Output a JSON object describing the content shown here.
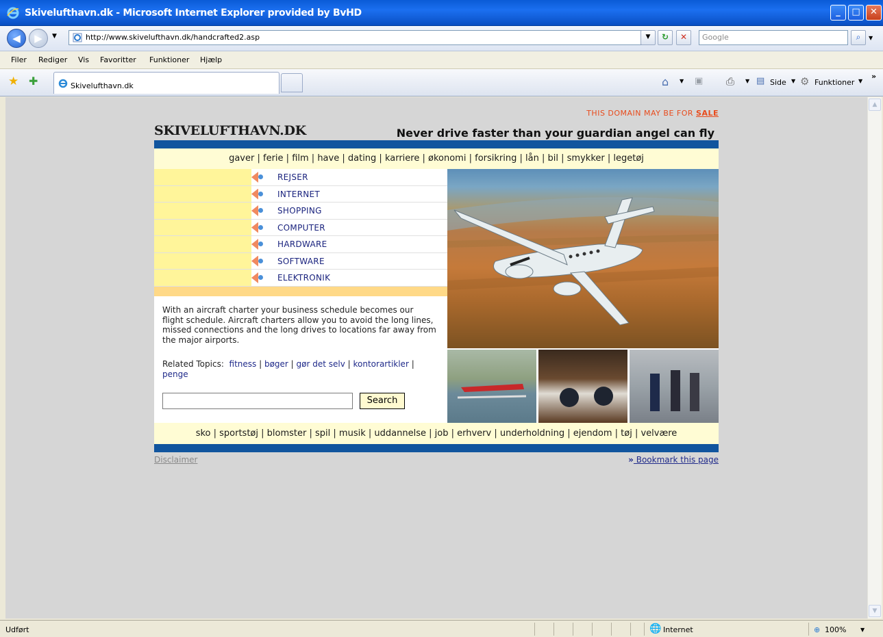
{
  "window": {
    "title": "Skivelufthavn.dk - Microsoft Internet Explorer provided by BvHD",
    "minimize": "_",
    "maximize": "□",
    "close": "✕"
  },
  "address": {
    "url": "http://www.skivelufthavn.dk/handcrafted2.asp",
    "search_placeholder": "Google"
  },
  "menu": [
    "Filer",
    "Rediger",
    "Vis",
    "Favoritter",
    "Funktioner",
    "Hjælp"
  ],
  "tab": {
    "title": "Skivelufthavn.dk"
  },
  "command_bar": {
    "page": "Side",
    "tools": "Funktioner",
    "more": "»"
  },
  "page": {
    "sale_text": "THIS DOMAIN MAY BE FOR",
    "sale_link": "SALE",
    "logo": "SKIVELUFTHAVN.DK",
    "slogan": "Never drive faster than your guardian angel can fly",
    "top_nav": [
      "gaver",
      "ferie",
      "film",
      "have",
      "dating",
      "karriere",
      "økonomi",
      "forsikring",
      "lån",
      "bil",
      "smykker",
      "legetøj"
    ],
    "side_menu": [
      "REJSER",
      "INTERNET",
      "SHOPPING",
      "COMPUTER",
      "HARDWARE",
      "SOFTWARE",
      "ELEKTRONIK"
    ],
    "description": "With an aircraft charter your business schedule becomes our flight schedule. Aircraft charters allow you to avoid the long lines, missed connections and the long drives to locations far away from the major airports.",
    "related_label": "Related Topics:",
    "related_topics": [
      "fitness",
      "bøger",
      "gør det selv",
      "kontorartikler",
      "penge"
    ],
    "search_button": "Search",
    "bottom_nav": [
      "sko",
      "sportstøj",
      "blomster",
      "spil",
      "musik",
      "uddannelse",
      "job",
      "erhverv",
      "underholdning",
      "ejendom",
      "tøj",
      "velvære"
    ],
    "disclaimer": "Disclaimer",
    "bookmark_prefix": "»",
    "bookmark": " Bookmark this page"
  },
  "status": {
    "text": "Udført",
    "zone": "Internet",
    "zoom": "100%"
  }
}
